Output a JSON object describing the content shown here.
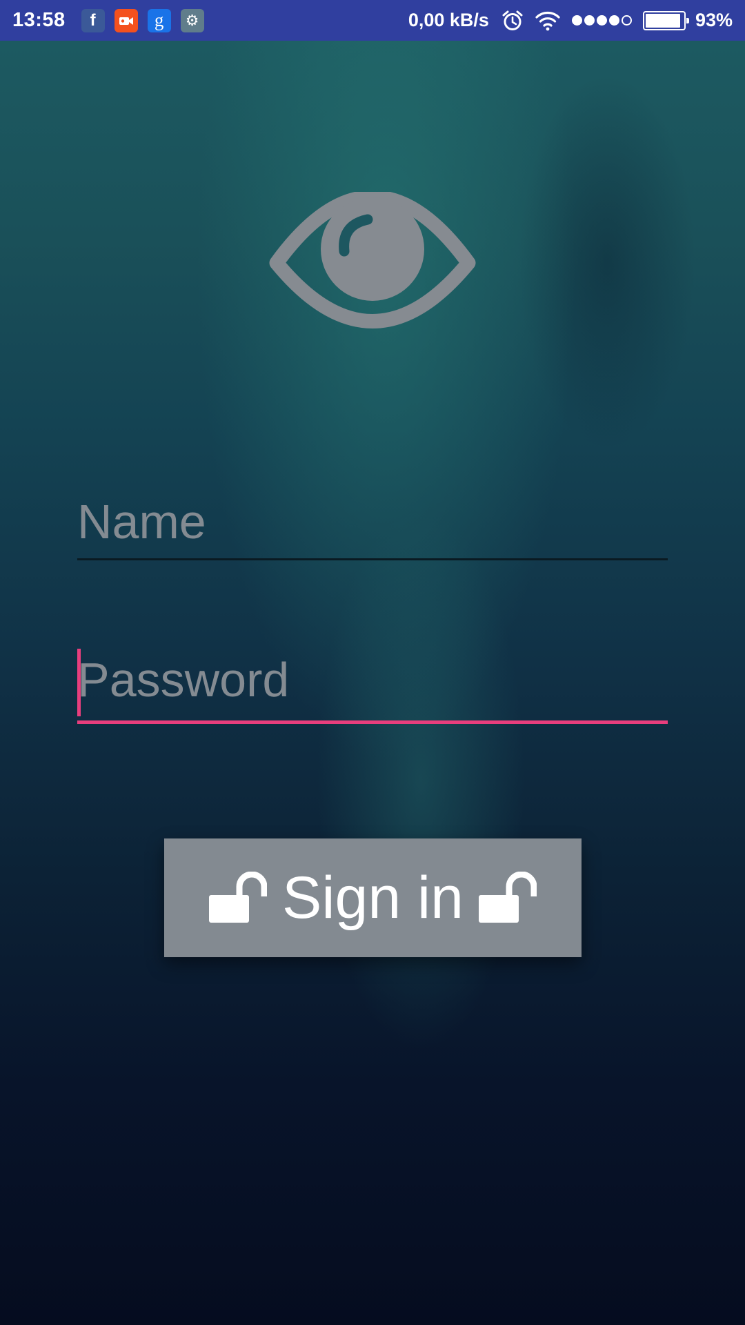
{
  "status_bar": {
    "time": "13:58",
    "notification_icons": [
      {
        "name": "facebook-icon",
        "glyph": "f",
        "color": "#3b5998"
      },
      {
        "name": "screen-recorder-icon",
        "glyph": "",
        "color": "#f4511e"
      },
      {
        "name": "google-icon",
        "glyph": "g",
        "color": "#1a73e8"
      },
      {
        "name": "settings-icon",
        "glyph": "⚙",
        "color": "#607d8b"
      }
    ],
    "net_speed": "0,00 kB/s",
    "signal_strength": {
      "filled": 4,
      "total": 5
    },
    "battery_level": 0.93,
    "battery_percent": "93%"
  },
  "logo": {
    "icon": "eye-icon",
    "color": "#868b91"
  },
  "form": {
    "name_placeholder": "Name",
    "name_value": "",
    "password_placeholder": "Password",
    "password_value": "",
    "focused_field": "password",
    "accent_color": "#e83e7d"
  },
  "signin_button": {
    "label": "Sign in",
    "left_icon": "unlocked-padlock-icon",
    "right_icon": "unlocked-padlock-icon"
  },
  "colors": {
    "status_bar": "#303f9f",
    "button_background": "#838a91",
    "placeholder": "#848b92"
  }
}
